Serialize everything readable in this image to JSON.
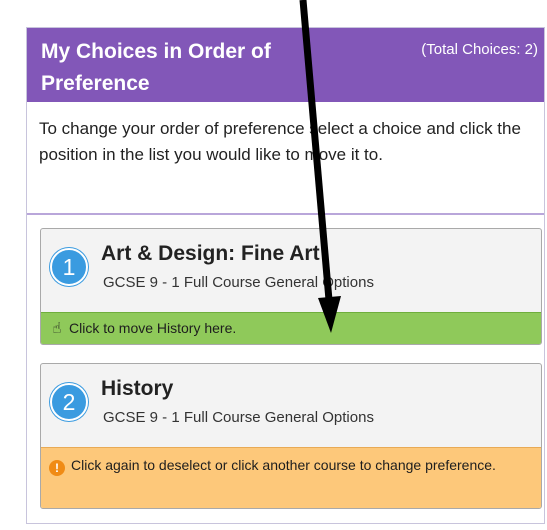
{
  "panel": {
    "title": "My Choices in Order of Preference",
    "total": "(Total Choices: 2)",
    "instructions": "To change your order of preference select a choice and click the position in the list you would like to move it to."
  },
  "choices": [
    {
      "position": "1",
      "title": "Art & Design: Fine Art",
      "subtitle": "GCSE 9 - 1 Full Course General Options",
      "action_text": "Click to move History here.",
      "action_icon": "hand-pointer-icon"
    },
    {
      "position": "2",
      "title": "History",
      "subtitle": "GCSE 9 - 1 Full Course General Options",
      "action_text": "Click again to deselect or click another course to change preference.",
      "action_icon": "info-icon"
    }
  ],
  "colors": {
    "header": "#8257b8",
    "badge": "#3a9be0",
    "move_bar": "#8fc95a",
    "deselect_bar": "#fdc87a",
    "info_icon": "#f08b15"
  }
}
